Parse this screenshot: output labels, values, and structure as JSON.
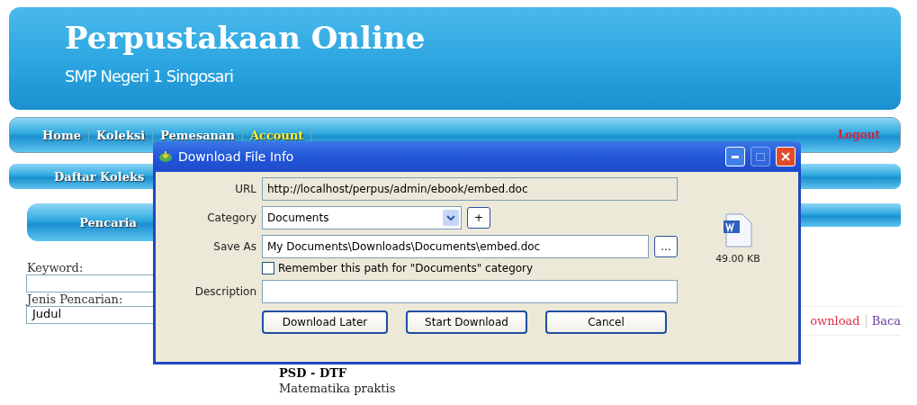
{
  "header": {
    "title": "Perpustakaan Online",
    "subtitle": "SMP Negeri 1 Singosari"
  },
  "nav": {
    "items": [
      {
        "label": "Home",
        "selected": false
      },
      {
        "label": "Koleksi",
        "selected": false
      },
      {
        "label": "Pemesanan",
        "selected": false
      },
      {
        "label": "Account",
        "selected": true
      }
    ],
    "logout": "Logout"
  },
  "section_bar": {
    "title": "Daftar Koleks"
  },
  "sidebar": {
    "heading": "Pencaria",
    "keyword_label": "Keyword:",
    "search_type_label": "Jenis Pencarian:",
    "search_type_value": "Judul"
  },
  "content": {
    "links": [
      {
        "label": "ownload",
        "color": "#e0304a"
      },
      {
        "label": "Baca",
        "color": "#6a3fa0"
      }
    ],
    "entries": [
      {
        "title": "PSD - DTF",
        "subtitle": "Matematika praktis"
      }
    ]
  },
  "dialog": {
    "title": "Download File Info",
    "maximize_disabled": true,
    "url_label": "URL",
    "url": "http://localhost/perpus/admin/ebook/embed.doc",
    "category_label": "Category",
    "category": "Documents",
    "add_button": "+",
    "save_as_label": "Save As",
    "save_as": "My Documents\\Downloads\\Documents\\embed.doc",
    "browse_button": "...",
    "remember": {
      "label": "Remember this path for \"Documents\" category",
      "checked": false
    },
    "description_label": "Description",
    "file_size": "49.00  KB",
    "buttons": [
      "Download Later",
      "Start Download",
      "Cancel"
    ]
  }
}
